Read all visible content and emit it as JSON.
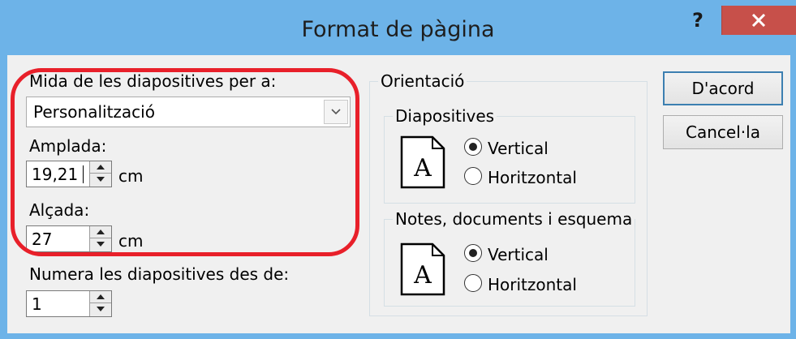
{
  "window": {
    "title": "Format de pàgina",
    "help_label": "?",
    "close_label": "×"
  },
  "size": {
    "label": "Mida de les diapositives per a:",
    "selected": "Personalització"
  },
  "width": {
    "label": "Amplada:",
    "value": "19,21",
    "unit": "cm"
  },
  "height": {
    "label": "Alçada:",
    "value": "27",
    "unit": "cm"
  },
  "numbering": {
    "label": "Numera les diapositives des de:",
    "value": "1"
  },
  "orientation": {
    "title": "Orientació",
    "slides": {
      "title": "Diapositives",
      "icon_letter": "A",
      "options": [
        "Vertical",
        "Horitzontal"
      ],
      "selected": "Vertical"
    },
    "notes": {
      "title": "Notes, documents i esquema",
      "icon_letter": "A",
      "options": [
        "Vertical",
        "Horitzontal"
      ],
      "selected": "Vertical"
    }
  },
  "buttons": {
    "ok": "D'acord",
    "cancel": "Cancel·la"
  },
  "colors": {
    "frame": "#6db3e8",
    "close_button": "#c7504a",
    "highlight": "#e8202a"
  }
}
